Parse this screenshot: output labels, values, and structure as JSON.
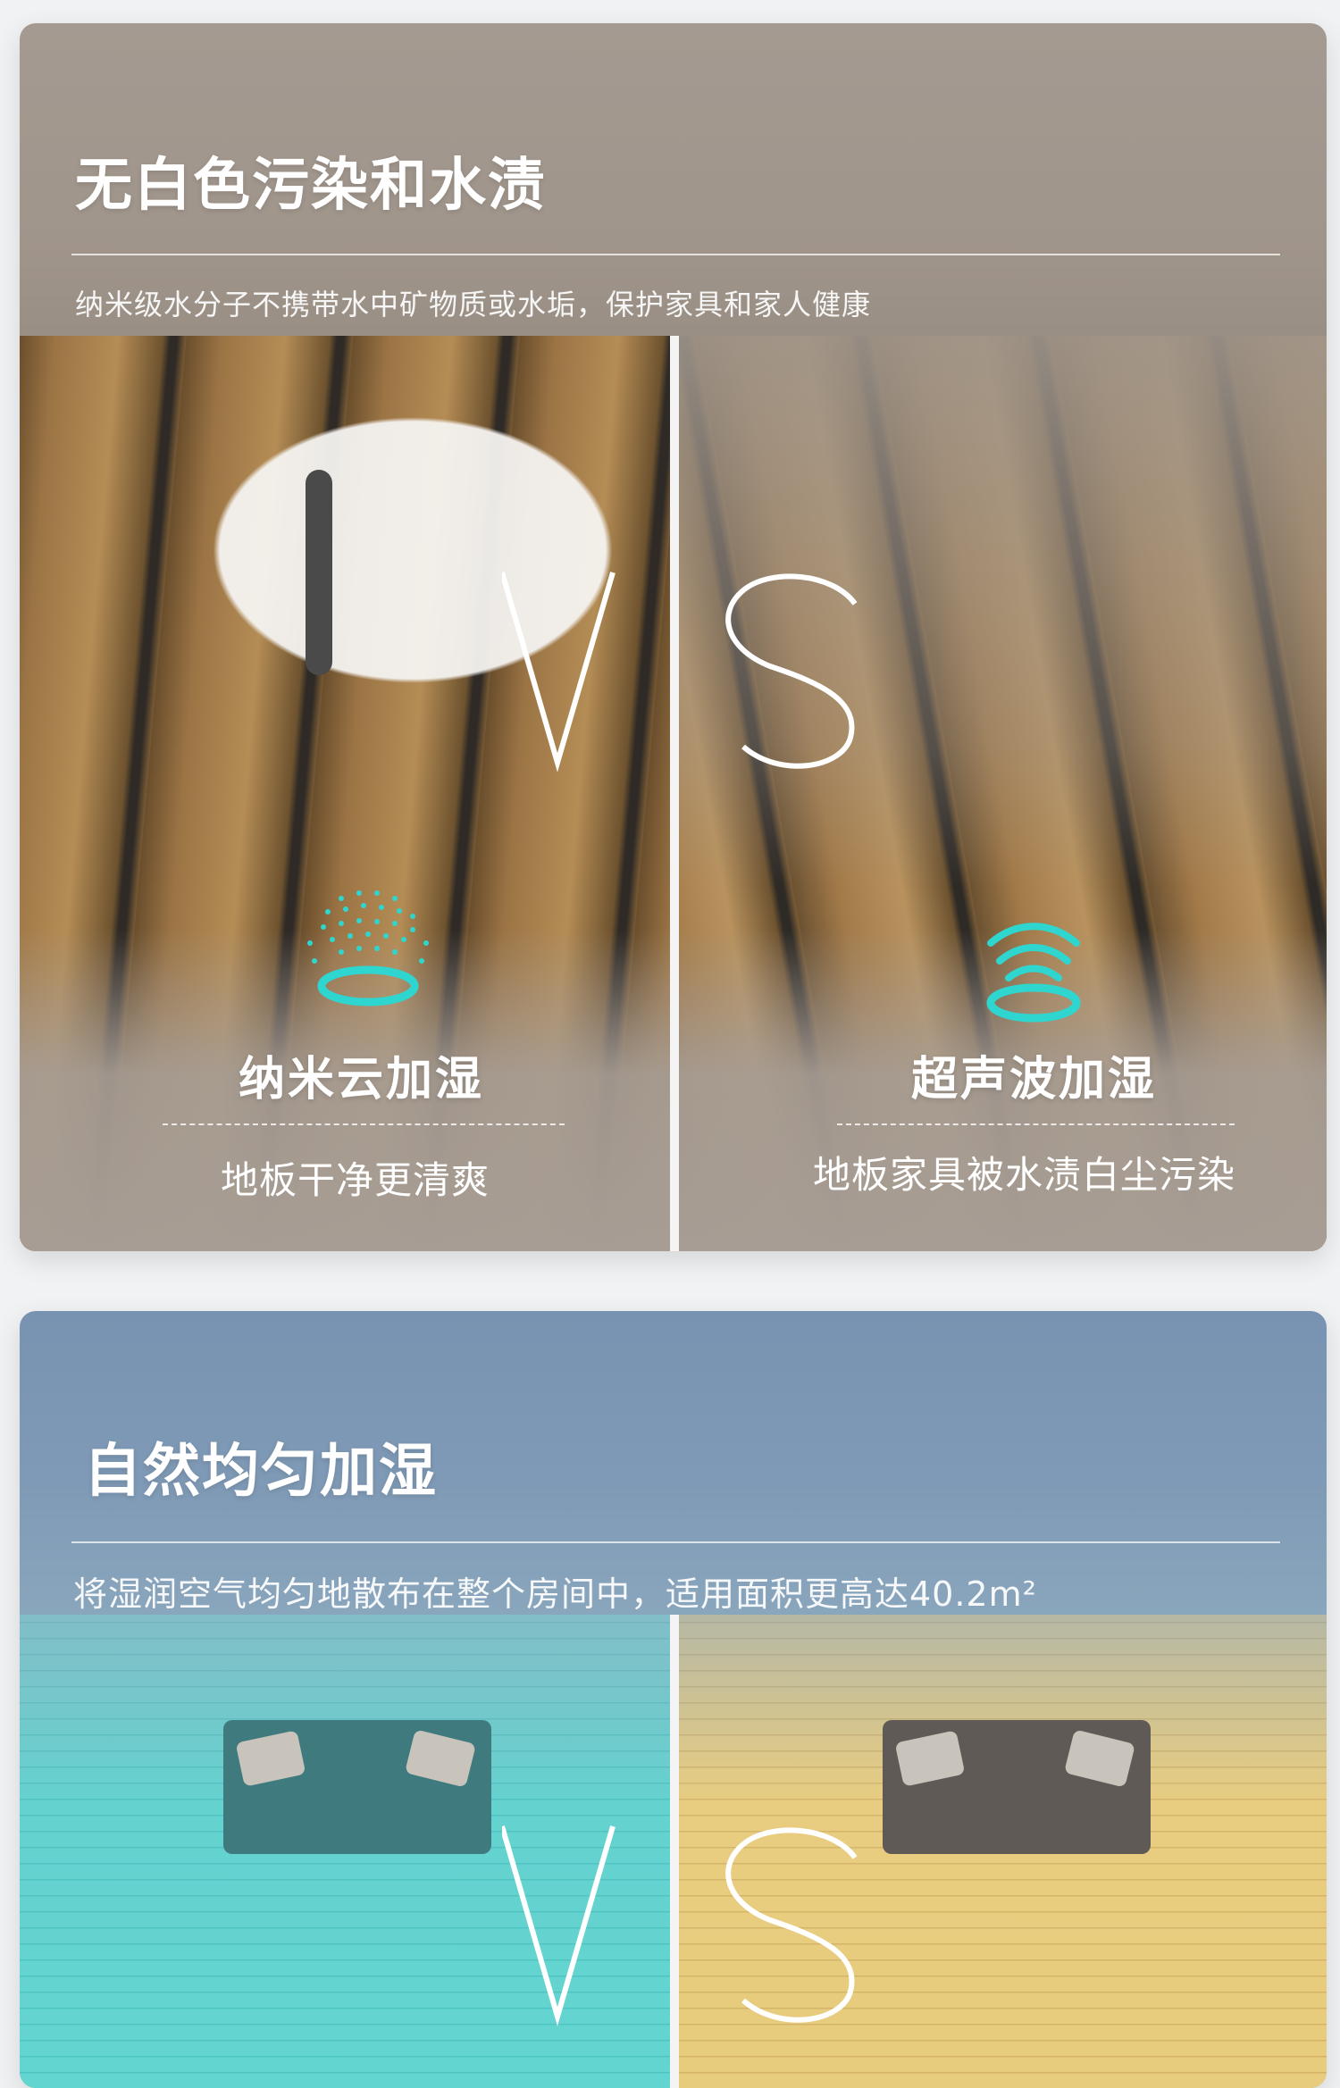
{
  "sections": [
    {
      "title": "无白色污染和水渍",
      "subtitle": "纳米级水分子不携带水中矿物质或水垢，保护家具和家人健康",
      "vs_letters": [
        "V",
        "S"
      ],
      "left": {
        "name": "纳米云加湿",
        "desc": "地板干净更清爽",
        "icon": "nano-mist-icon"
      },
      "right": {
        "name": "超声波加湿",
        "desc": "地板家具被水渍白尘污染",
        "icon": "ultrasonic-icon"
      }
    },
    {
      "title": "自然均匀加湿",
      "subtitle": "将湿润空气均匀地散布在整个房间中，适用面积更高达40.2m²",
      "vs_letters": [
        "V",
        "S"
      ]
    }
  ],
  "colors": {
    "accent": "#2fd6d0",
    "card_top": "#a49a91",
    "card_blue": "#7893b1"
  }
}
